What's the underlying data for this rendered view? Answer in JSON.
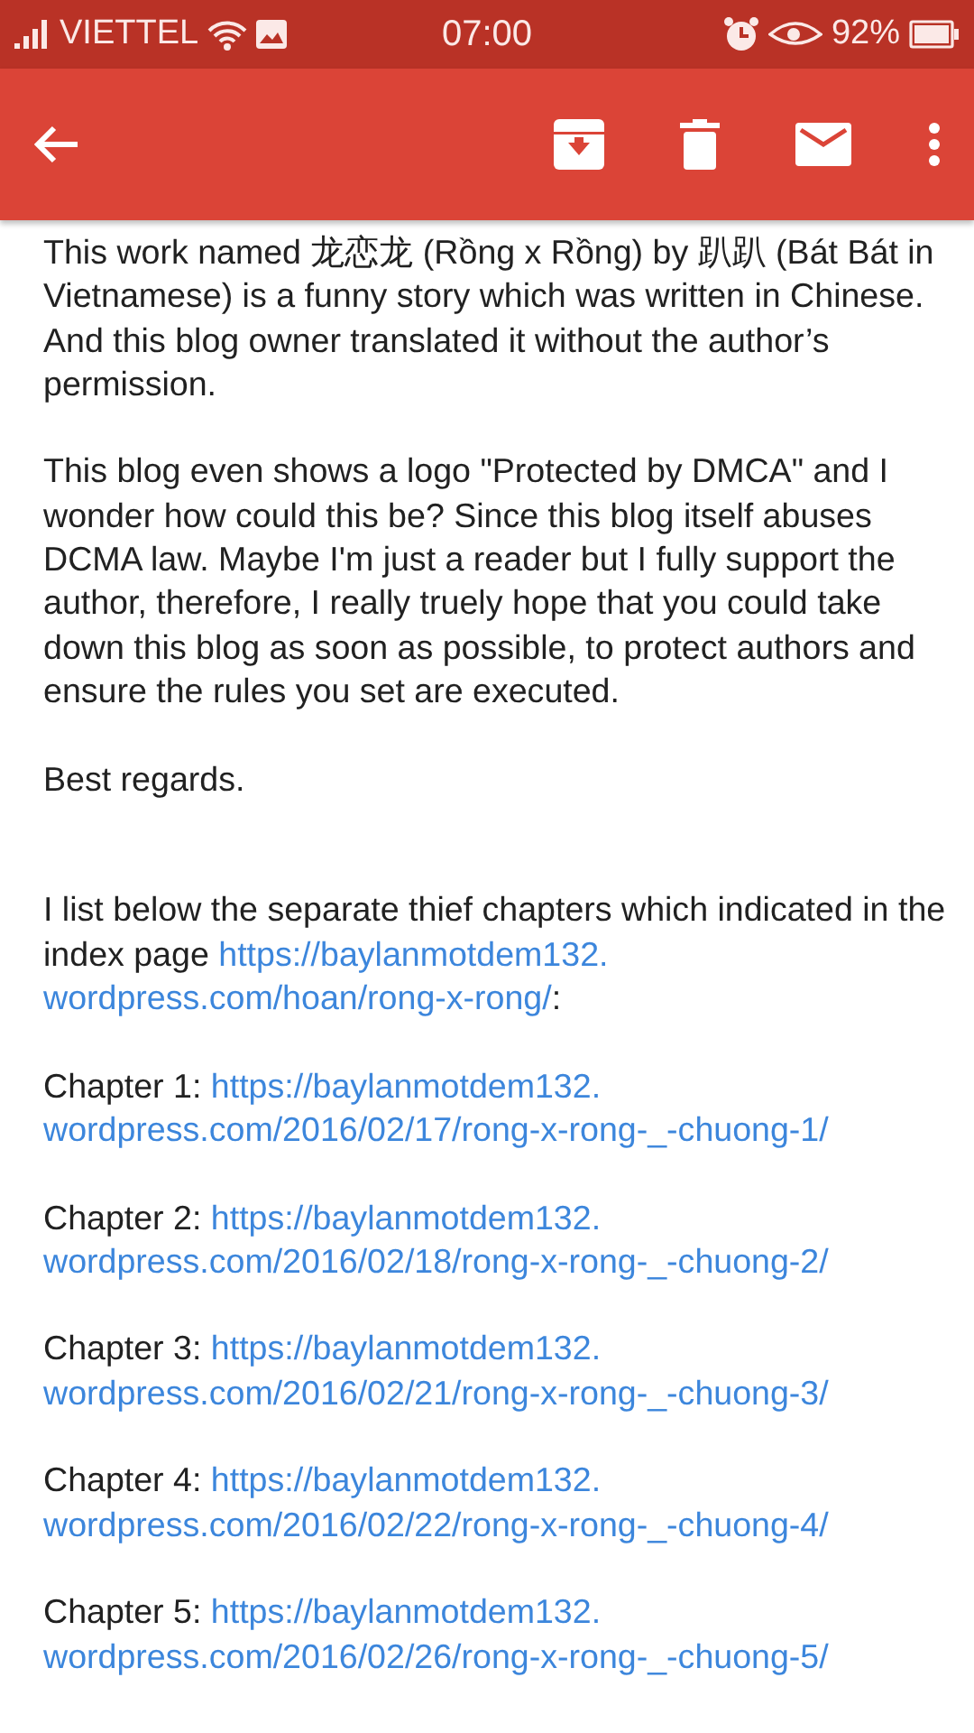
{
  "status_bar": {
    "carrier": "VIETTEL",
    "time": "07:00",
    "battery": "92%"
  },
  "message": {
    "paragraphs": [
      "This work named 龙恋龙 (Rồng x Rồng) by 趴趴 (Bát Bát in Vietnamese) is a funny story which was written in Chinese. And this blog owner translated it without the author’s permission.",
      "This blog even shows a logo \"Protected by DMCA\" and I wonder how could this be? Since this blog itself abuses DCMA law. Maybe I'm just a reader but I fully support the author, therefore, I really truely hope that you could take down this blog as soon as possible, to protect authors and ensure the rules you set are executed.",
      "Best regards."
    ],
    "index_note": {
      "text": "I list below the separate thief chapters which indicated in the index page",
      "link_lines": [
        "https://baylanmotdem132.",
        "wordpress.com/hoan/rong-x-rong/"
      ],
      "after": ":"
    },
    "chapters": [
      {
        "label": "Chapter 1:",
        "link_lines": [
          "https://baylanmotdem132.",
          "wordpress.com/2016/02/17/rong-x-rong-_-chuong-1/"
        ]
      },
      {
        "label": "Chapter 2:",
        "link_lines": [
          "https://baylanmotdem132.",
          "wordpress.com/2016/02/18/rong-x-rong-_-chuong-2/"
        ]
      },
      {
        "label": "Chapter 3:",
        "link_lines": [
          "https://baylanmotdem132.",
          "wordpress.com/2016/02/21/rong-x-rong-_-chuong-3/"
        ]
      },
      {
        "label": "Chapter 4:",
        "link_lines": [
          "https://baylanmotdem132.",
          "wordpress.com/2016/02/22/rong-x-rong-_-chuong-4/"
        ]
      },
      {
        "label": "Chapter 5:",
        "link_lines": [
          "https://baylanmotdem132.",
          "wordpress.com/2016/02/26/rong-x-rong-_-chuong-5/"
        ]
      }
    ]
  }
}
